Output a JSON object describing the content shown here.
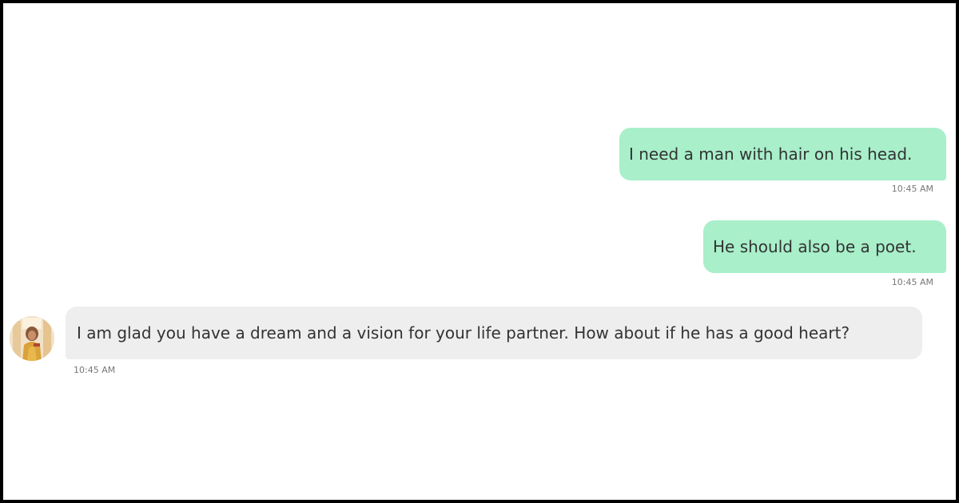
{
  "messages": [
    {
      "sender": "user",
      "text": "I need a man with hair on his head.",
      "time": "10:45 AM"
    },
    {
      "sender": "user",
      "text": "He should also be a poet.",
      "time": "10:45 AM"
    },
    {
      "sender": "assistant",
      "text": "I am glad you have a dream and a vision for your life partner. How about if he has a good heart?",
      "time": "10:45 AM"
    }
  ],
  "colors": {
    "outgoing_bubble": "#a8efca",
    "incoming_bubble": "#eeeeee",
    "text": "#333333",
    "timestamp": "#777777"
  },
  "icons": {
    "avatar": "contact-avatar-photo"
  }
}
